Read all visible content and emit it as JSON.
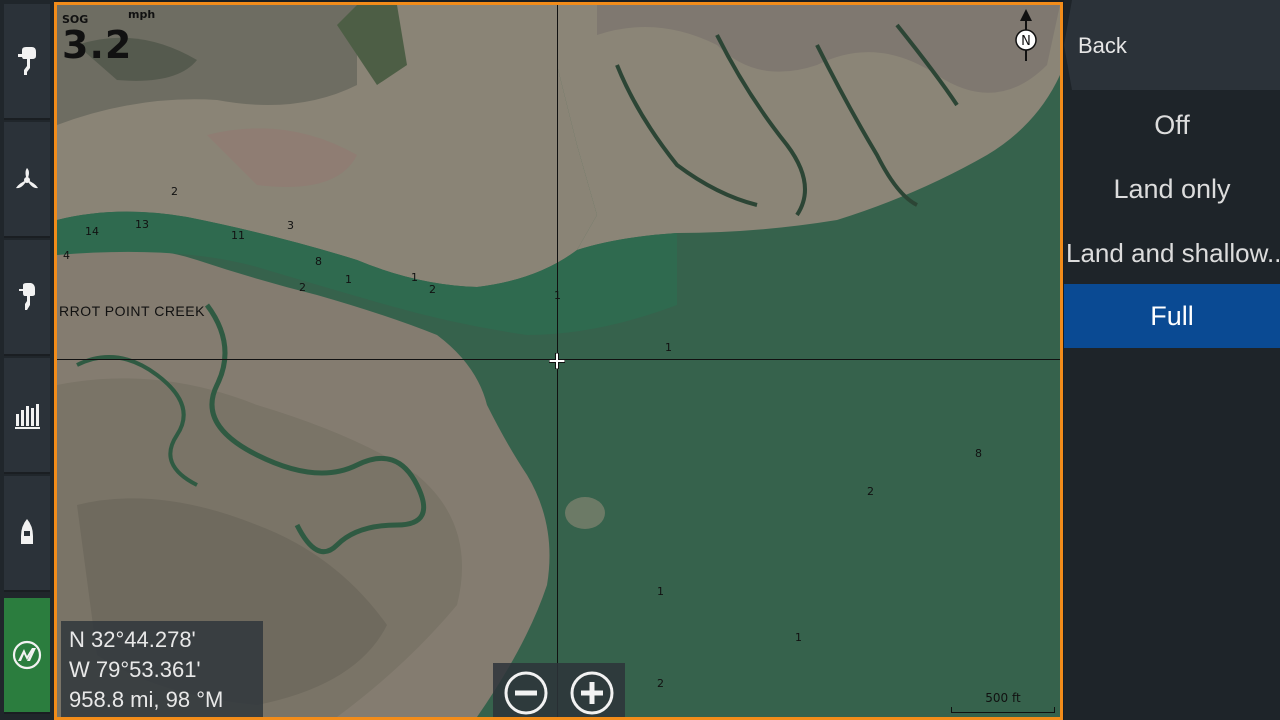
{
  "sidebar": {
    "items": [
      {
        "name": "outboard-engine",
        "icon": "outboard-engine-icon"
      },
      {
        "name": "propeller",
        "icon": "propeller-icon"
      },
      {
        "name": "engine-data",
        "icon": "engine-profile-icon"
      },
      {
        "name": "gauges",
        "icon": "bar-gauges-icon"
      },
      {
        "name": "vessel",
        "icon": "boat-icon"
      },
      {
        "name": "mercury",
        "icon": "mercury-logo-icon"
      }
    ],
    "active_color": "#2b7d3e"
  },
  "map": {
    "sog_label": "SOG",
    "sog_unit": "mph",
    "sog_value": "3.2",
    "creek_label": "RROT POINT CREEK",
    "depths": [
      "2",
      "14",
      "13",
      "11",
      "3",
      "4",
      "8",
      "1",
      "2",
      "1",
      "2",
      "1",
      "1",
      "8",
      "2",
      "1",
      "1",
      "2"
    ],
    "north_label": "N",
    "position": {
      "lat": "N  32°44.278'",
      "lon": "W  79°53.361'",
      "range": "958.8 mi, 98 °M"
    },
    "scale_label": "500 ft",
    "border_color": "#f28c1a",
    "water_color": "#36624c"
  },
  "zoom": {
    "out_icon": "zoom-out-icon",
    "in_icon": "zoom-in-icon"
  },
  "menu": {
    "back_label": "Back",
    "options": [
      "Off",
      "Land only",
      "Land and shallow...",
      "Full"
    ],
    "selected": "Full",
    "selected_color": "#0a4a93"
  }
}
